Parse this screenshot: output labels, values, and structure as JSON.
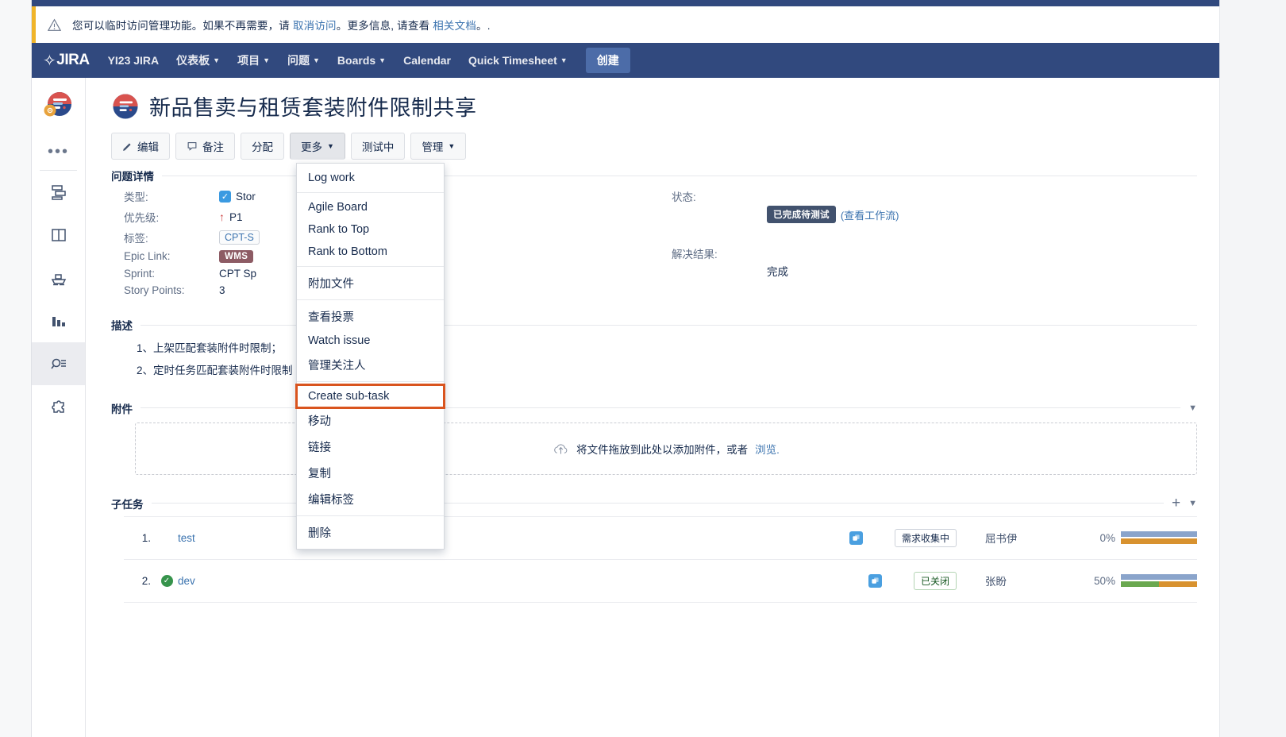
{
  "banner": {
    "text_before": "您可以临时访问管理功能。如果不再需要，请 ",
    "link1": "取消访问",
    "text_mid": "。更多信息, 请查看 ",
    "link2": "相关文档",
    "text_after": "。."
  },
  "nav": {
    "logo": "JIRA",
    "site": "YI23 JIRA",
    "items": [
      {
        "label": "仪表板",
        "caret": true
      },
      {
        "label": "项目",
        "caret": true
      },
      {
        "label": "问题",
        "caret": true
      },
      {
        "label": "Boards",
        "caret": true
      },
      {
        "label": "Calendar",
        "caret": false
      },
      {
        "label": "Quick Timesheet",
        "caret": true
      }
    ],
    "create": "创建"
  },
  "rail": {
    "dots": "•••",
    "items": [
      {
        "name": "backlog-icon"
      },
      {
        "name": "board-icon"
      },
      {
        "name": "release-icon"
      },
      {
        "name": "reports-icon"
      },
      {
        "name": "issues-icon"
      },
      {
        "name": "addons-icon"
      }
    ]
  },
  "issue": {
    "title": "新品售卖与租赁套装附件限制共享"
  },
  "toolbar": {
    "edit": "编辑",
    "comment": "备注",
    "assign": "分配",
    "more": "更多",
    "testing": "测试中",
    "admin": "管理"
  },
  "more_menu": {
    "groups": [
      [
        "Log work"
      ],
      [
        "Agile Board",
        "Rank to Top",
        "Rank to Bottom"
      ],
      [
        "附加文件"
      ],
      [
        "查看投票",
        "Watch issue",
        "管理关注人"
      ],
      [
        "Create sub-task"
      ],
      [
        "移动",
        "链接",
        "复制",
        "编辑标签"
      ],
      [
        "删除"
      ]
    ],
    "highlighted": "Create sub-task"
  },
  "details": {
    "heading": "问题详情",
    "left": [
      {
        "label": "类型:",
        "value": "Stor",
        "kind": "type"
      },
      {
        "label": "优先级:",
        "value": "P1",
        "kind": "priority"
      },
      {
        "label": "标签:",
        "value": "CPT-S",
        "kind": "label"
      },
      {
        "label": "Epic Link:",
        "value": "WMS",
        "kind": "epic"
      },
      {
        "label": "Sprint:",
        "value": "CPT Sp",
        "kind": "text"
      },
      {
        "label": "Story Points:",
        "value": "3",
        "kind": "text"
      }
    ],
    "right": [
      {
        "label": "状态:",
        "value": "已完成待测试",
        "kind": "status",
        "link": "(查看工作流)"
      },
      {
        "label": "解决结果:",
        "value": "完成",
        "kind": "text"
      }
    ]
  },
  "description": {
    "heading": "描述",
    "lines": [
      "1、上架匹配套装附件时限制；",
      "2、定时任务匹配套装附件时限制"
    ]
  },
  "attachments": {
    "heading": "附件",
    "drop_text": "将文件拖放到此处以添加附件，或者",
    "browse": "浏览."
  },
  "subtasks": {
    "heading": "子任务",
    "rows": [
      {
        "num": "1.",
        "name": "test",
        "done": false,
        "status": "需求收集中",
        "status_kind": "open",
        "assignee": "屈书伊",
        "percent": "0%",
        "bar_top": [
          {
            "color": "blue",
            "pct": 100
          }
        ],
        "bar_bottom": [
          {
            "color": "orange",
            "pct": 100
          }
        ]
      },
      {
        "num": "2.",
        "name": "dev",
        "done": true,
        "status": "已关闭",
        "status_kind": "closed",
        "assignee": "张盼",
        "percent": "50%",
        "bar_top": [
          {
            "color": "blue",
            "pct": 100
          }
        ],
        "bar_bottom": [
          {
            "color": "green",
            "pct": 50
          },
          {
            "color": "orange",
            "pct": 50
          }
        ]
      }
    ]
  },
  "colors": {
    "nav": "#31497e",
    "accent_link": "#3b73af",
    "highlight": "#d9541e",
    "epic": "#8d5b64",
    "status": "#42526e",
    "bar_blue": "#8aa4cb",
    "bar_green": "#6aa84f",
    "bar_orange": "#d8922f"
  }
}
